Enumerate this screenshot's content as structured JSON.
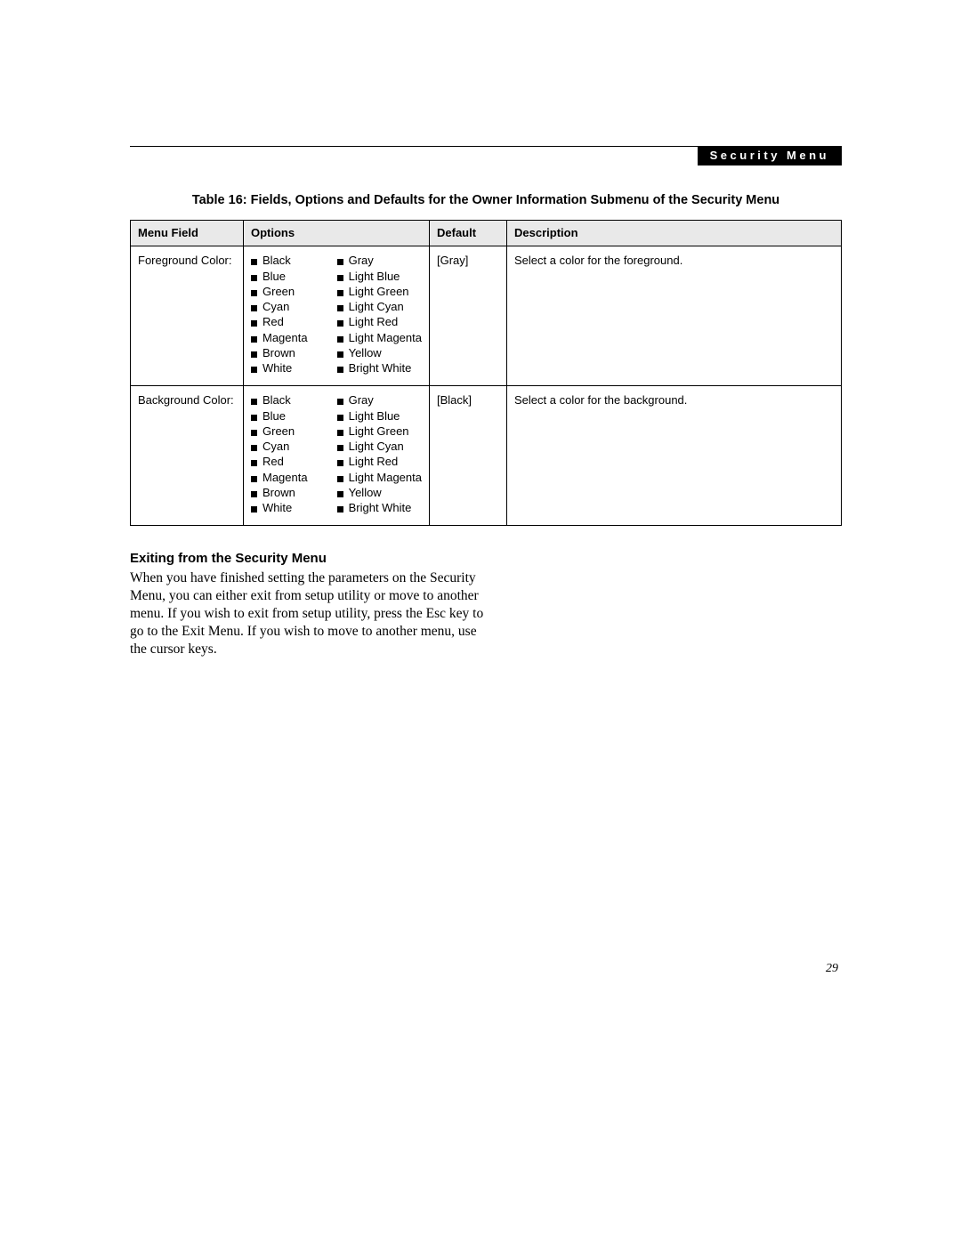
{
  "header": {
    "section_label": "Security Menu"
  },
  "table": {
    "caption": "Table 16: Fields, Options and Defaults for the Owner Information Submenu of the Security Menu",
    "headers": {
      "menu_field": "Menu Field",
      "options": "Options",
      "default": "Default",
      "description": "Description"
    },
    "rows": [
      {
        "menu_field": "Foreground Color:",
        "options_a": [
          "Black",
          "Blue",
          "Green",
          "Cyan",
          "Red",
          "Magenta",
          "Brown",
          "White"
        ],
        "options_b": [
          "Gray",
          "Light Blue",
          "Light Green",
          "Light Cyan",
          "Light Red",
          "Light Magenta",
          "Yellow",
          "Bright White"
        ],
        "default": "[Gray]",
        "description": "Select a color for the foreground."
      },
      {
        "menu_field": "Background Color:",
        "options_a": [
          "Black",
          "Blue",
          "Green",
          "Cyan",
          "Red",
          "Magenta",
          "Brown",
          "White"
        ],
        "options_b": [
          "Gray",
          "Light Blue",
          "Light Green",
          "Light Cyan",
          "Light Red",
          "Light Magenta",
          "Yellow",
          "Bright White"
        ],
        "default": "[Black]",
        "description": "Select a color for the background."
      }
    ]
  },
  "section": {
    "heading": "Exiting from the Security Menu",
    "body": "When you have finished setting the parameters on the Security Menu, you can either exit from setup utility or move to another menu. If you wish to exit from setup utility, press the Esc key to go to the Exit Menu. If you wish to move to another menu, use the cursor keys."
  },
  "page_number": "29"
}
